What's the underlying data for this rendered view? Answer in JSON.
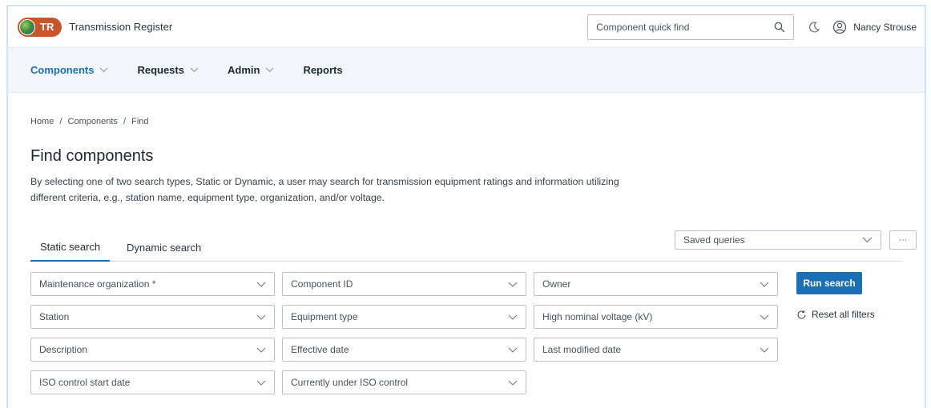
{
  "header": {
    "logo_abbr": "TR",
    "app_title": "Transmission Register",
    "quick_find_placeholder": "Component quick find",
    "user_name": "Nancy Strouse",
    "icons": [
      "globe-logo-icon",
      "search-icon",
      "moon-icon",
      "user-icon"
    ]
  },
  "nav": {
    "items": [
      {
        "label": "Components",
        "active": true,
        "has_dropdown": true
      },
      {
        "label": "Requests",
        "active": false,
        "has_dropdown": true
      },
      {
        "label": "Admin",
        "active": false,
        "has_dropdown": true
      },
      {
        "label": "Reports",
        "active": false,
        "has_dropdown": false
      }
    ]
  },
  "breadcrumb": [
    "Home",
    "/",
    "Components",
    "/",
    "Find"
  ],
  "page": {
    "title": "Find components",
    "description": "By selecting one of two search types, Static or Dynamic, a user may search for transmission equipment ratings and information utilizing different criteria, e.g., station name, equipment type, organization, and/or voltage."
  },
  "tabs": [
    {
      "label": "Static search",
      "active": true
    },
    {
      "label": "Dynamic search",
      "active": false
    }
  ],
  "saved_queries": {
    "label": "Saved queries",
    "more_label": "···"
  },
  "filters": {
    "maintenance_organization": "Maintenance organization *",
    "component_id": "Component ID",
    "owner": "Owner",
    "station": "Station",
    "equipment_type": "Equipment type",
    "high_nominal_voltage": "High nominal voltage (kV)",
    "description": "Description",
    "effective_date": "Effective date",
    "last_modified_date": "Last modified date",
    "iso_control_start_date": "ISO control start date",
    "currently_under_iso_control": "Currently under ISO control"
  },
  "actions": {
    "run_search": "Run search",
    "reset_all_filters": "Reset all filters"
  },
  "colors": {
    "accent": "#1a6fb5",
    "logo_bg": "#c9562b",
    "nav_bg": "#f3f7fb"
  }
}
